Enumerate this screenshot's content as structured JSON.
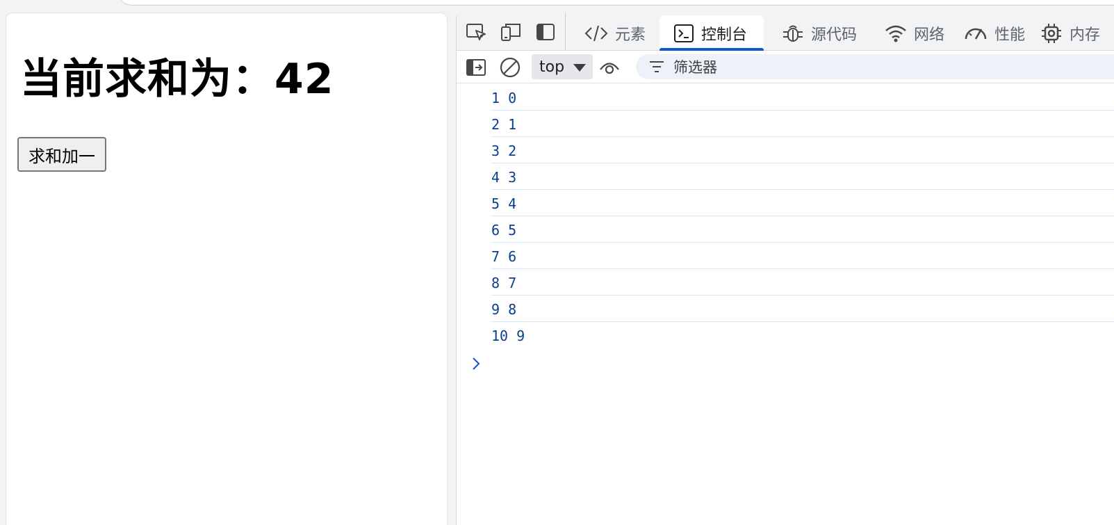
{
  "page": {
    "heading": "当前求和为：42",
    "button_label": "求和加一"
  },
  "devtools": {
    "tabs": [
      {
        "label": "元素",
        "icon": "code-icon",
        "active": false
      },
      {
        "label": "控制台",
        "icon": "console-icon",
        "active": true
      },
      {
        "label": "源代码",
        "icon": "bug-icon",
        "active": false
      },
      {
        "label": "网络",
        "icon": "wifi-icon",
        "active": false
      },
      {
        "label": "性能",
        "icon": "gauge-icon",
        "active": false
      },
      {
        "label": "内存",
        "icon": "chip-icon",
        "active": false
      }
    ],
    "toolbar": {
      "context": "top",
      "filter_placeholder": "筛选器"
    },
    "console_lines": [
      "1 0",
      "2 1",
      "3 2",
      "4 3",
      "5 4",
      "6 5",
      "7 6",
      "8 7",
      "9 8",
      "10 9"
    ]
  },
  "colors": {
    "accent": "#0b57d0",
    "log_text": "#0b3e8e",
    "log_separator": "#d2e3fc",
    "filter_bg": "#eef2f8"
  }
}
